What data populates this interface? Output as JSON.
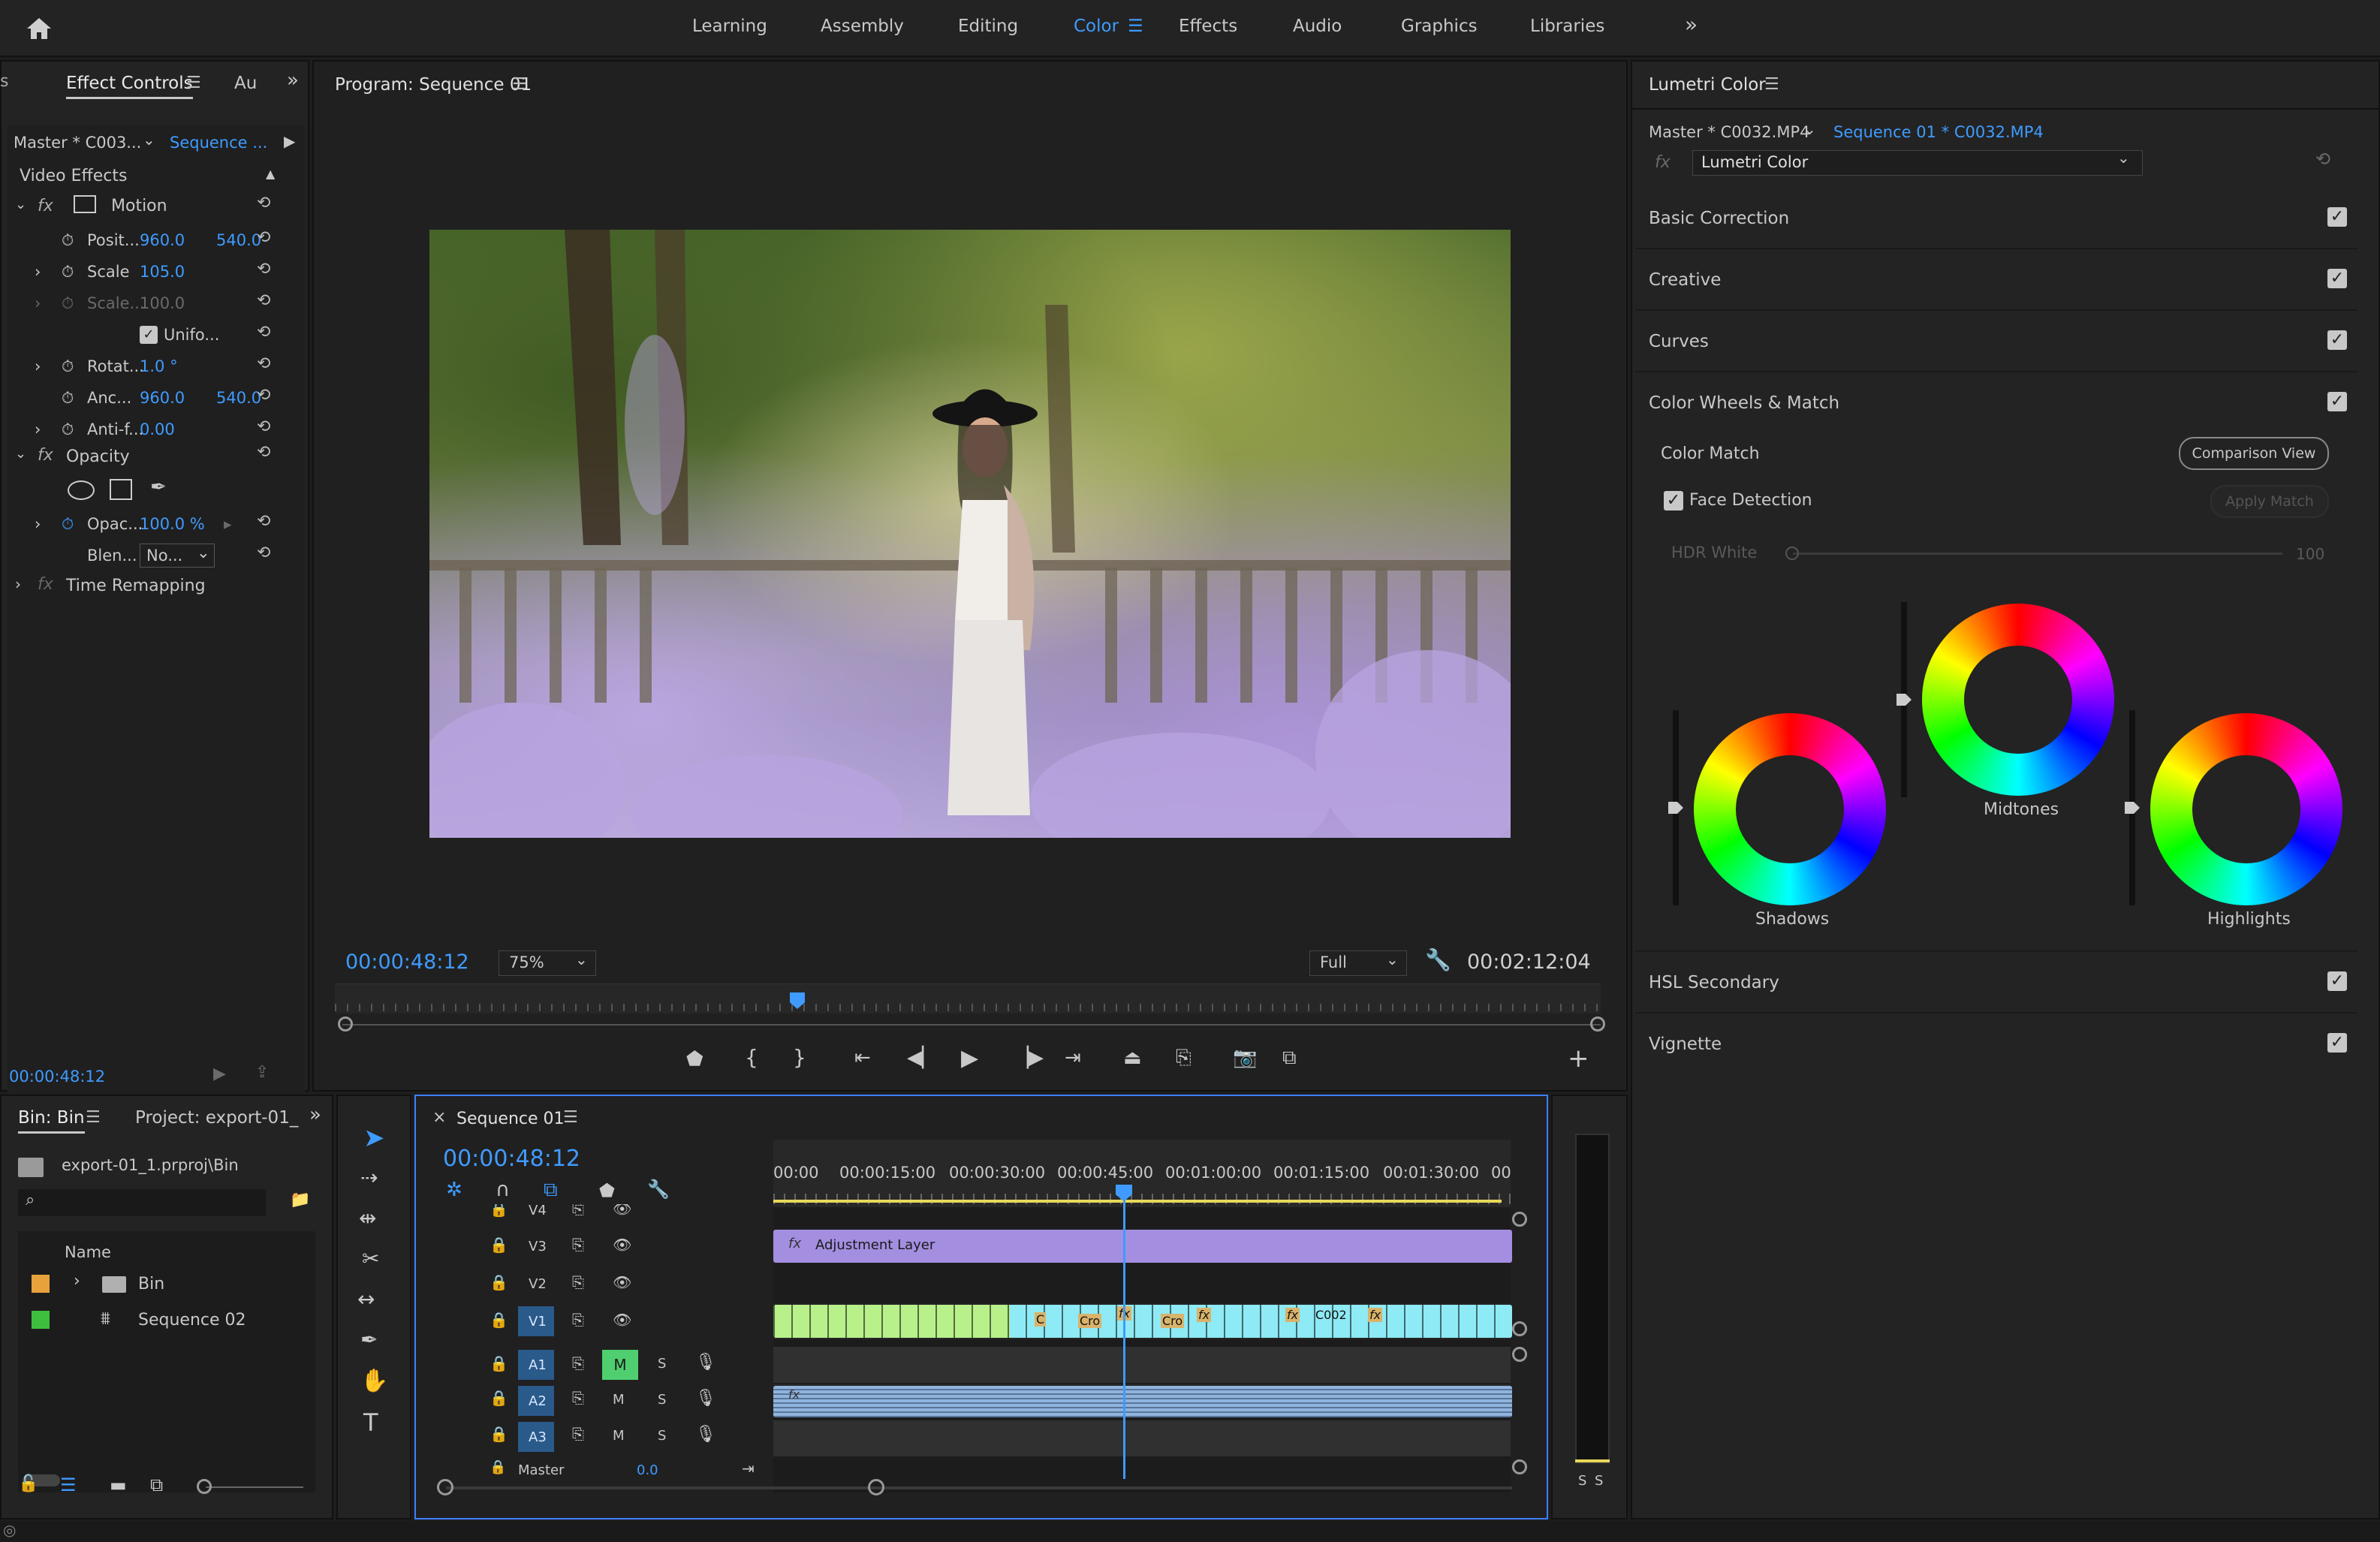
{
  "workspaces": [
    {
      "label": "Learning",
      "active": false
    },
    {
      "label": "Assembly",
      "active": false
    },
    {
      "label": "Editing",
      "active": false
    },
    {
      "label": "Color",
      "active": true
    },
    {
      "label": "Effects",
      "active": false
    },
    {
      "label": "Audio",
      "active": false
    },
    {
      "label": "Graphics",
      "active": false
    },
    {
      "label": "Libraries",
      "active": false
    }
  ],
  "effect_controls": {
    "tab": "Effect Controls",
    "tab2": "Au",
    "master_label": "Master * C003...",
    "sequence_label": "Sequence ...",
    "video_effects": "Video Effects",
    "motion": "Motion",
    "position_label": "Posit...",
    "position_x": "960.0",
    "position_y": "540.0",
    "scale_label": "Scale",
    "scale_value": "105.0",
    "scale_width_label": "Scale...",
    "scale_width_value": "100.0",
    "uniform_label": "Unifo...",
    "rotation_label": "Rotat...",
    "rotation_value": "1.0 °",
    "anchor_label": "Anc...",
    "anchor_x": "960.0",
    "anchor_y": "540.0",
    "antiflicker_label": "Anti-f...",
    "antiflicker_value": "0.00",
    "opacity": "Opacity",
    "opacity_label": "Opac...",
    "opacity_value": "100.0 %",
    "blend_label": "Blen...",
    "blend_value": "No...",
    "time_remapping": "Time Remapping",
    "timecode": "00:00:48:12"
  },
  "program": {
    "title": "Program: Sequence 01",
    "timecode": "00:00:48:12",
    "zoom": "75%",
    "quality": "Full",
    "duration": "00:02:12:04"
  },
  "project": {
    "tab_bin": "Bin: Bin",
    "tab_project": "Project: export-01_",
    "path": "export-01_1.prproj\\Bin",
    "search_placeholder": "",
    "col_name": "Name",
    "items": [
      {
        "name": "Bin",
        "color": "#e8a23c",
        "type": "folder"
      },
      {
        "name": "Sequence 02",
        "color": "#3fbf3f",
        "type": "sequence"
      }
    ]
  },
  "timeline": {
    "tab": "Sequence 01",
    "timecode": "00:00:48:12",
    "ruler": [
      "00:00",
      "00:00:15:00",
      "00:00:30:00",
      "00:00:45:00",
      "00:01:00:00",
      "00:01:15:00",
      "00:01:30:00",
      "00"
    ],
    "tracks": [
      {
        "id": "V4",
        "type": "video"
      },
      {
        "id": "V3",
        "type": "video"
      },
      {
        "id": "V2",
        "type": "video"
      },
      {
        "id": "V1",
        "type": "video"
      },
      {
        "id": "A1",
        "type": "audio"
      },
      {
        "id": "A2",
        "type": "audio"
      },
      {
        "id": "A3",
        "type": "audio"
      }
    ],
    "master_label": "Master",
    "master_value": "0.0",
    "adjustment_layer": "Adjustment Layer",
    "v1_clip_labels": [
      "C",
      "Cro",
      "fx",
      "Cro",
      "fx",
      "fx",
      "C002",
      "fx"
    ],
    "m_label": "M",
    "s_label": "S"
  },
  "lumetri": {
    "title": "Lumetri Color",
    "master_label": "Master * C0032.MP4",
    "sequence_label": "Sequence 01 * C0032.MP4",
    "effect_select": "Lumetri Color",
    "sections": [
      "Basic Correction",
      "Creative",
      "Curves",
      "Color Wheels & Match"
    ],
    "sections_bottom": [
      "HSL Secondary",
      "Vignette"
    ],
    "color_match": "Color Match",
    "comparison_view": "Comparison View",
    "face_detection": "Face Detection",
    "apply_match": "Apply Match",
    "hdr_white": "HDR White",
    "hdr_value": "100",
    "wheels": {
      "shadows": "Shadows",
      "midtones": "Midtones",
      "highlights": "Highlights"
    }
  },
  "meters": {
    "left": "S",
    "right": "S"
  }
}
